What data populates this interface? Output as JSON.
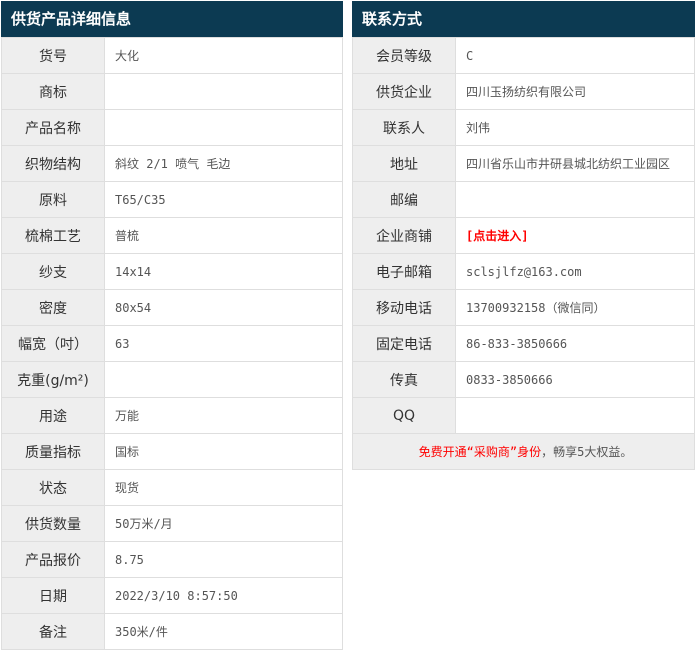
{
  "colors": {
    "header_bg": "#0c3a52",
    "label_bg": "#eeeeee",
    "border": "#dedede",
    "link_red": "#ff0000"
  },
  "product_panel": {
    "title": "供货产品详细信息",
    "rows": [
      {
        "label": "货号",
        "value": "大化"
      },
      {
        "label": "商标",
        "value": ""
      },
      {
        "label": "产品名称",
        "value": ""
      },
      {
        "label": "织物结构",
        "value": "斜纹 2/1 喷气 毛边"
      },
      {
        "label": "原料",
        "value": "T65/C35"
      },
      {
        "label": "梳棉工艺",
        "value": "普梳"
      },
      {
        "label": "纱支",
        "value": "14x14"
      },
      {
        "label": "密度",
        "value": "80x54"
      },
      {
        "label": "幅宽（吋）",
        "value": "63"
      },
      {
        "label": "克重(g/m²)",
        "value": ""
      },
      {
        "label": "用途",
        "value": "万能"
      },
      {
        "label": "质量指标",
        "value": "国标"
      },
      {
        "label": "状态",
        "value": "现货"
      },
      {
        "label": "供货数量",
        "value": "50万米/月"
      },
      {
        "label": "产品报价",
        "value": "8.75"
      },
      {
        "label": "日期",
        "value": "2022/3/10 8:57:50"
      },
      {
        "label": "备注",
        "value": "350米/件"
      }
    ]
  },
  "contact_panel": {
    "title": "联系方式",
    "rows": [
      {
        "label": "会员等级",
        "value": "C"
      },
      {
        "label": "供货企业",
        "value": "四川玉扬纺织有限公司"
      },
      {
        "label": "联系人",
        "value": "刘伟"
      },
      {
        "label": "地址",
        "value": "四川省乐山市井研县城北纺织工业园区"
      },
      {
        "label": "邮编",
        "value": ""
      },
      {
        "label": "企业商铺",
        "value": "[点击进入]",
        "link": true
      },
      {
        "label": "电子邮箱",
        "value": "sclsjlfz@163.com"
      },
      {
        "label": "移动电话",
        "value": "13700932158（微信同）"
      },
      {
        "label": "固定电话",
        "value": "86-833-3850666"
      },
      {
        "label": "传真",
        "value": "0833-3850666"
      },
      {
        "label": "QQ",
        "value": ""
      }
    ],
    "notice": {
      "highlight": "免费开通“采购商”身份",
      "rest": "，畅享5大权益。"
    }
  }
}
